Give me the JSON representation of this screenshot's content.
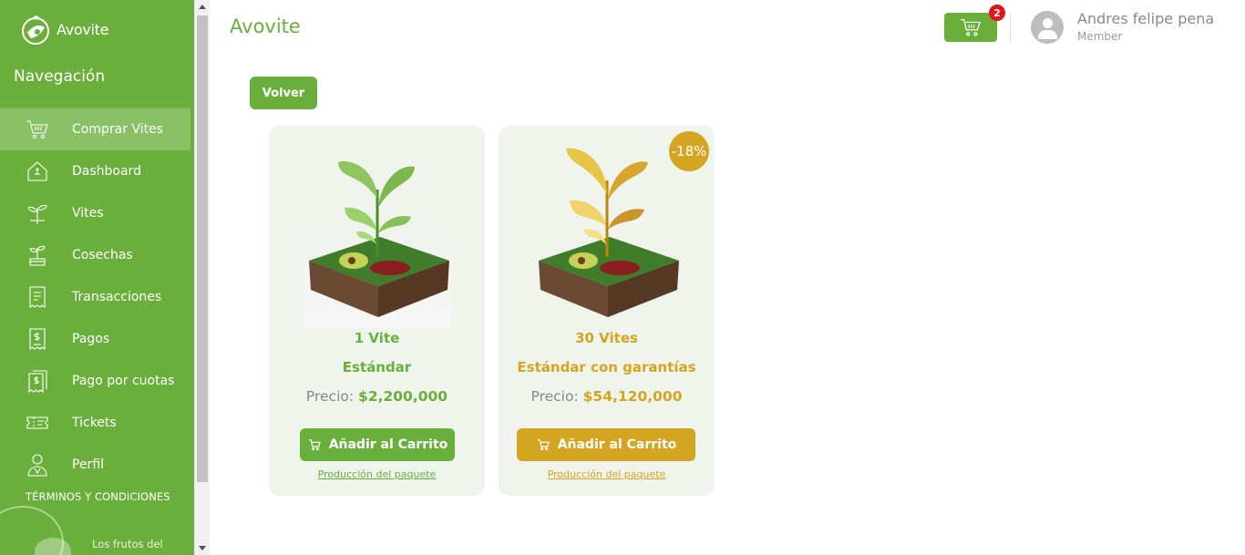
{
  "sidebar": {
    "logo_text": "Avovite",
    "nav_title": "Navegación",
    "items": [
      {
        "label": "Comprar Vites",
        "icon": "cart-icon",
        "active": true
      },
      {
        "label": "Dashboard",
        "icon": "house-icon"
      },
      {
        "label": "Vites",
        "icon": "sprout-icon"
      },
      {
        "label": "Cosechas",
        "icon": "harvest-icon"
      },
      {
        "label": "Transacciones",
        "icon": "receipt-icon"
      },
      {
        "label": "Pagos",
        "icon": "receipt-dollar-icon"
      },
      {
        "label": "Pago por cuotas",
        "icon": "receipts-stack-icon"
      },
      {
        "label": "Tickets",
        "icon": "ticket-icon"
      },
      {
        "label": "Perfil",
        "icon": "user-icon"
      }
    ],
    "terms": "TÉRMINOS Y CONDICIONES",
    "tagline": "Los frutos del"
  },
  "header": {
    "title": "Avovite",
    "cart_count": "2",
    "user_name": "Andres felipe pena",
    "user_role": "Member"
  },
  "back_label": "Volver",
  "products": [
    {
      "quantity": "1 Vite",
      "type": "Estándar",
      "price_label": "Precio:",
      "price": "$2,200,000",
      "add_label": "Añadir al Carrito",
      "link": "Producción del paquete",
      "theme": "green"
    },
    {
      "quantity": "30 Vites",
      "type": "Estándar con garantías",
      "price_label": "Precio:",
      "price": "$54,120,000",
      "add_label": "Añadir al Carrito",
      "link": "Producción del paquete",
      "discount": "-18%",
      "theme": "gold"
    }
  ],
  "colors": {
    "primary": "#6aaf3c",
    "gold": "#d4a520",
    "badge": "#e3141a"
  }
}
